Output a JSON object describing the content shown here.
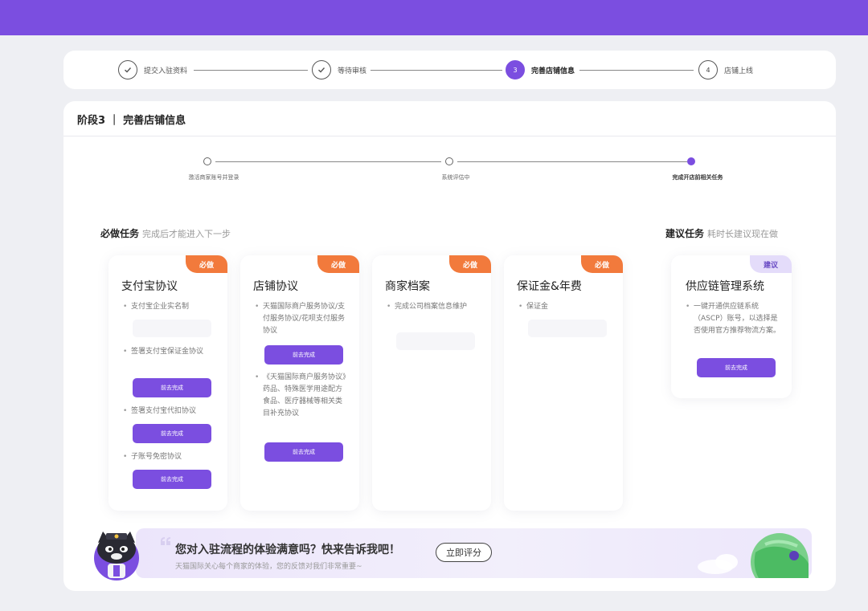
{
  "steps": [
    {
      "label": "提交入驻资料",
      "state": "done"
    },
    {
      "label": "等待审核",
      "state": "done"
    },
    {
      "label": "完善店铺信息",
      "state": "active",
      "num": "3"
    },
    {
      "label": "店铺上线",
      "state": "todo",
      "num": "4"
    }
  ],
  "stage": {
    "title": "阶段3 ｜ 完善店铺信息"
  },
  "sub_steps": [
    {
      "label": "激活商家账号并登录"
    },
    {
      "label": "系统评估中"
    },
    {
      "label": "完成开店前相关任务"
    }
  ],
  "required": {
    "title": "必做任务",
    "subtitle": "完成后才能进入下一步"
  },
  "suggested": {
    "title": "建议任务",
    "subtitle": "耗时长建议现在做"
  },
  "tasks": [
    {
      "badge": "必做",
      "title": "支付宝协议",
      "items": [
        "支付宝企业实名制",
        "签署支付宝保证金协议",
        "签署支付宝代扣协议",
        "子账号免密协议"
      ],
      "button": "前去完成"
    },
    {
      "badge": "必做",
      "title": "店铺协议",
      "items": [
        "天猫国际商户服务协议/支付服务协议/花呗支付服务协议",
        "《天猫国际商户服务协议》药品、特殊医学用途配方食品、医疗器械等相关类目补充协议"
      ],
      "button": "前去完成"
    },
    {
      "badge": "必做",
      "title": "商家档案",
      "items": [
        "完成公司档案信息维护"
      ]
    },
    {
      "badge": "必做",
      "title": "保证金&年费",
      "items": [
        "保证金"
      ]
    },
    {
      "badge": "建议",
      "title": "供应链管理系统",
      "items": [
        "一键开通供应链系统（ASCP）账号，以选择是否使用官方推荐物流方案。"
      ],
      "button": "前去完成"
    }
  ],
  "banner": {
    "title": "您对入驻流程的体验满意吗？快来告诉我吧！",
    "subtitle": "天猫国际关心每个商家的体验，您的反馈对我们非常重要~",
    "button": "立即评分"
  },
  "colors": {
    "accent": "#7b4ee0",
    "required_badge": "#f27a3c",
    "suggest_badge": "#e4dcfa"
  },
  "icons": [
    "check-icon",
    "cat-mascot-icon",
    "quote-icon"
  ]
}
